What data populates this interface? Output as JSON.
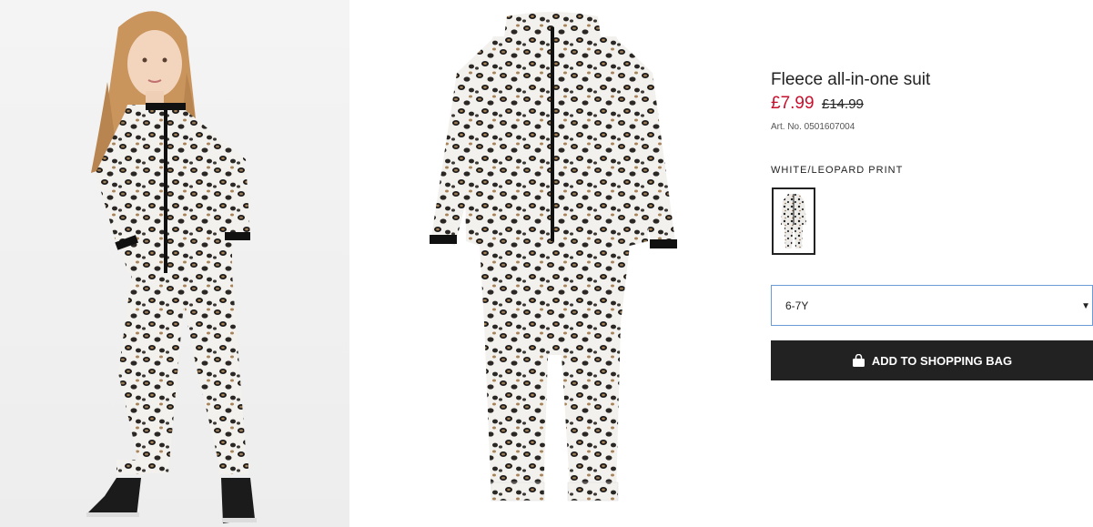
{
  "images": {
    "model_image": "girl-model-wearing-leopard-suit",
    "product_image": "leopard-print-fleece-suit"
  },
  "product": {
    "title": "Fleece all-in-one suit",
    "price_sale": "£7.99",
    "price_old": "£14.99",
    "article_number": "Art. No. 0501607004",
    "color_label": "WHITE/LEOPARD PRINT",
    "swatch_icon": "suit-thumbnail"
  },
  "size_select": {
    "selected": "6-7Y",
    "caret_icon": "caret-down-icon"
  },
  "add_button": {
    "label": "ADD TO SHOPPING BAG",
    "icon": "shopping-bag-icon"
  },
  "colors": {
    "sale_price": "#c8102e",
    "button_bg": "#222222",
    "select_border": "#6b9bd6"
  }
}
